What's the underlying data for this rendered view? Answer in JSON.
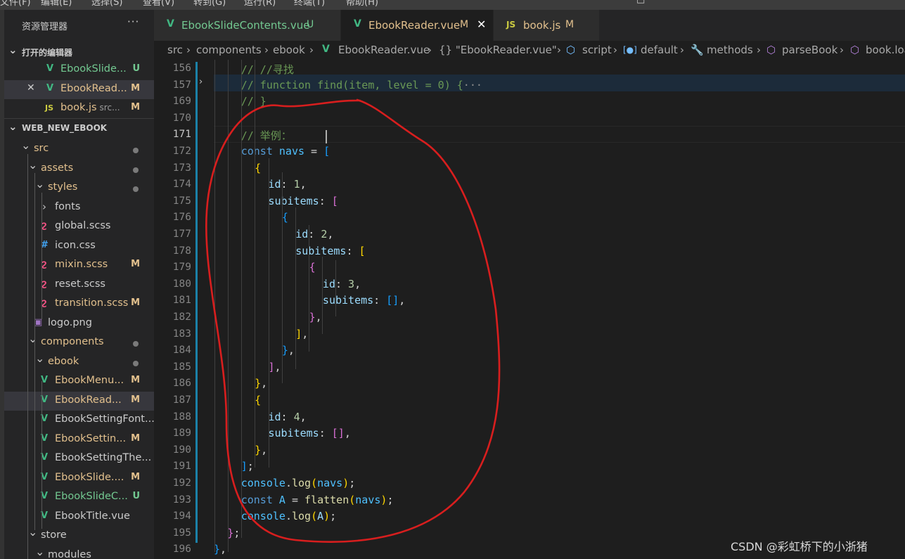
{
  "menubar": {
    "items": [
      "文件(F)",
      "编辑(E)",
      "选择(S)",
      "查看(V)",
      "转到(G)",
      "运行(R)",
      "终端(T)",
      "帮助(H)"
    ]
  },
  "sidebar": {
    "title": "资源管理器",
    "open_editors": {
      "header": "打开的编辑器",
      "items": [
        {
          "name": "EbookSlide...",
          "badge": "U",
          "icon": "vue",
          "desc": ""
        },
        {
          "name": "EbookRead...",
          "badge": "M",
          "icon": "vue",
          "desc": ""
        },
        {
          "name": "book.js",
          "badge": "M",
          "icon": "js",
          "desc": "src..."
        }
      ]
    },
    "project": {
      "header": "WEB_NEW_EBOOK",
      "tree": [
        {
          "label": "src",
          "type": "folder",
          "indent": 1,
          "badge": "dot"
        },
        {
          "label": "assets",
          "type": "folder",
          "indent": 2,
          "badge": "dot"
        },
        {
          "label": "styles",
          "type": "folder",
          "indent": 3,
          "badge": "dot"
        },
        {
          "label": "fonts",
          "type": "folder-closed",
          "indent": 4,
          "badge": ""
        },
        {
          "label": "global.scss",
          "type": "scss",
          "indent": 4,
          "badge": ""
        },
        {
          "label": "icon.css",
          "type": "css",
          "indent": 4,
          "badge": ""
        },
        {
          "label": "mixin.scss",
          "type": "scss",
          "indent": 4,
          "badge": "M"
        },
        {
          "label": "reset.scss",
          "type": "scss",
          "indent": 4,
          "badge": ""
        },
        {
          "label": "transition.scss",
          "type": "scss",
          "indent": 4,
          "badge": "M"
        },
        {
          "label": "logo.png",
          "type": "png",
          "indent": 3,
          "badge": ""
        },
        {
          "label": "components",
          "type": "folder",
          "indent": 2,
          "badge": "dot"
        },
        {
          "label": "ebook",
          "type": "folder",
          "indent": 3,
          "badge": "dot"
        },
        {
          "label": "EbookMenu...",
          "type": "vue",
          "indent": 4,
          "badge": "M"
        },
        {
          "label": "EbookRead...",
          "type": "vue",
          "indent": 4,
          "badge": "M"
        },
        {
          "label": "EbookSettingFont...",
          "type": "vue",
          "indent": 4,
          "badge": ""
        },
        {
          "label": "EbookSettin...",
          "type": "vue",
          "indent": 4,
          "badge": "M"
        },
        {
          "label": "EbookSettingThe...",
          "type": "vue",
          "indent": 4,
          "badge": ""
        },
        {
          "label": "EbookSlide....",
          "type": "vue",
          "indent": 4,
          "badge": "M"
        },
        {
          "label": "EbookSlideC...",
          "type": "vue",
          "indent": 4,
          "badge": "U"
        },
        {
          "label": "EbookTitle.vue",
          "type": "vue",
          "indent": 4,
          "badge": ""
        },
        {
          "label": "store",
          "type": "folder",
          "indent": 2,
          "badge": ""
        },
        {
          "label": "modules",
          "type": "folder",
          "indent": 3,
          "badge": ""
        }
      ]
    }
  },
  "tabs": [
    {
      "label": "EbookSlideContents.vue",
      "mark": "U",
      "icon": "V"
    },
    {
      "label": "EbookReader.vue",
      "mark": "M",
      "icon": "V"
    },
    {
      "label": "book.js",
      "mark": "M",
      "icon": "JS"
    }
  ],
  "breadcrumb": [
    "src",
    "components",
    "ebook",
    "EbookReader.vue",
    "{} \"EbookReader.vue\"",
    "script",
    "default",
    "methods",
    "parseBook",
    "book.loa"
  ],
  "editor": {
    "lines": [
      {
        "n": "156",
        "tokens": [
          [
            "c",
            "// //寻找"
          ]
        ]
      },
      {
        "n": "157",
        "tokens": [
          [
            "c",
            "// function find(item, level = 0) {"
          ],
          [
            "f",
            "···"
          ]
        ]
      },
      {
        "n": "169",
        "tokens": [
          [
            "c",
            "// }"
          ]
        ]
      },
      {
        "n": "170",
        "tokens": []
      },
      {
        "n": "171",
        "tokens": [
          [
            "c",
            "// 举例："
          ]
        ]
      },
      {
        "n": "172",
        "tokens": [
          [
            "k",
            "const "
          ],
          [
            "v",
            "navs"
          ],
          [
            "p",
            " = "
          ],
          [
            "b3",
            "["
          ]
        ]
      },
      {
        "n": "173",
        "tokens": [
          [
            "b1",
            "{"
          ]
        ]
      },
      {
        "n": "174",
        "tokens": [
          [
            "pr",
            "id"
          ],
          [
            "p",
            ": "
          ],
          [
            "n",
            "1"
          ],
          [
            "p",
            ","
          ]
        ]
      },
      {
        "n": "175",
        "tokens": [
          [
            "pr",
            "subitems"
          ],
          [
            "p",
            ": "
          ],
          [
            "b2",
            "["
          ]
        ]
      },
      {
        "n": "176",
        "tokens": [
          [
            "b3",
            "{"
          ]
        ]
      },
      {
        "n": "177",
        "tokens": [
          [
            "pr",
            "id"
          ],
          [
            "p",
            ": "
          ],
          [
            "n",
            "2"
          ],
          [
            "p",
            ","
          ]
        ]
      },
      {
        "n": "178",
        "tokens": [
          [
            "pr",
            "subitems"
          ],
          [
            "p",
            ": "
          ],
          [
            "b1",
            "["
          ]
        ]
      },
      {
        "n": "179",
        "tokens": [
          [
            "b2",
            "{"
          ]
        ]
      },
      {
        "n": "180",
        "tokens": [
          [
            "pr",
            "id"
          ],
          [
            "p",
            ": "
          ],
          [
            "n",
            "3"
          ],
          [
            "p",
            ","
          ]
        ]
      },
      {
        "n": "181",
        "tokens": [
          [
            "pr",
            "subitems"
          ],
          [
            "p",
            ": "
          ],
          [
            "b3",
            "[]"
          ],
          [
            "p",
            ","
          ]
        ]
      },
      {
        "n": "182",
        "tokens": [
          [
            "b2",
            "}"
          ],
          [
            "p",
            ","
          ]
        ]
      },
      {
        "n": "183",
        "tokens": [
          [
            "b1",
            "]"
          ],
          [
            "p",
            ","
          ]
        ]
      },
      {
        "n": "184",
        "tokens": [
          [
            "b3",
            "}"
          ],
          [
            "p",
            ","
          ]
        ]
      },
      {
        "n": "185",
        "tokens": [
          [
            "b2",
            "]"
          ],
          [
            "p",
            ","
          ]
        ]
      },
      {
        "n": "186",
        "tokens": [
          [
            "b1",
            "}"
          ],
          [
            "p",
            ","
          ]
        ]
      },
      {
        "n": "187",
        "tokens": [
          [
            "b1",
            "{"
          ]
        ]
      },
      {
        "n": "188",
        "tokens": [
          [
            "pr",
            "id"
          ],
          [
            "p",
            ": "
          ],
          [
            "n",
            "4"
          ],
          [
            "p",
            ","
          ]
        ]
      },
      {
        "n": "189",
        "tokens": [
          [
            "pr",
            "subitems"
          ],
          [
            "p",
            ": "
          ],
          [
            "b2",
            "[]"
          ],
          [
            "p",
            ","
          ]
        ]
      },
      {
        "n": "190",
        "tokens": [
          [
            "b1",
            "}"
          ],
          [
            "p",
            ","
          ]
        ]
      },
      {
        "n": "191",
        "tokens": [
          [
            "b3",
            "]"
          ],
          [
            "p",
            ";"
          ]
        ]
      },
      {
        "n": "192",
        "tokens": [
          [
            "v",
            "console"
          ],
          [
            "p",
            "."
          ],
          [
            "fn",
            "log"
          ],
          [
            "b1",
            "("
          ],
          [
            "v",
            "navs"
          ],
          [
            "b1",
            ")"
          ],
          [
            "p",
            ";"
          ]
        ]
      },
      {
        "n": "193",
        "tokens": [
          [
            "k",
            "const "
          ],
          [
            "v",
            "A"
          ],
          [
            "p",
            " = "
          ],
          [
            "fn",
            "flatten"
          ],
          [
            "b1",
            "("
          ],
          [
            "v",
            "navs"
          ],
          [
            "b1",
            ")"
          ],
          [
            "p",
            ";"
          ]
        ]
      },
      {
        "n": "194",
        "tokens": [
          [
            "v",
            "console"
          ],
          [
            "p",
            "."
          ],
          [
            "fn",
            "log"
          ],
          [
            "b1",
            "("
          ],
          [
            "pr",
            "A"
          ],
          [
            "b1",
            ")"
          ],
          [
            "p",
            ";"
          ]
        ]
      },
      {
        "n": "195",
        "tokens": [
          [
            "b2",
            "}"
          ],
          [
            "p",
            ";"
          ]
        ]
      },
      {
        "n": "196",
        "tokens": [
          [
            "b3",
            "}"
          ],
          [
            "p",
            ","
          ]
        ]
      }
    ],
    "current_line": "171"
  },
  "watermark": "CSDN @彩虹桥下的小浙猪",
  "colors": {
    "vue": "#41b883",
    "js": "#cbcb41",
    "scss": "#f55385",
    "css": "#42a5f5",
    "png": "#a074c4",
    "untracked": "#73c991",
    "modified": "#e2c08d",
    "annotation": "#d81e1e"
  }
}
